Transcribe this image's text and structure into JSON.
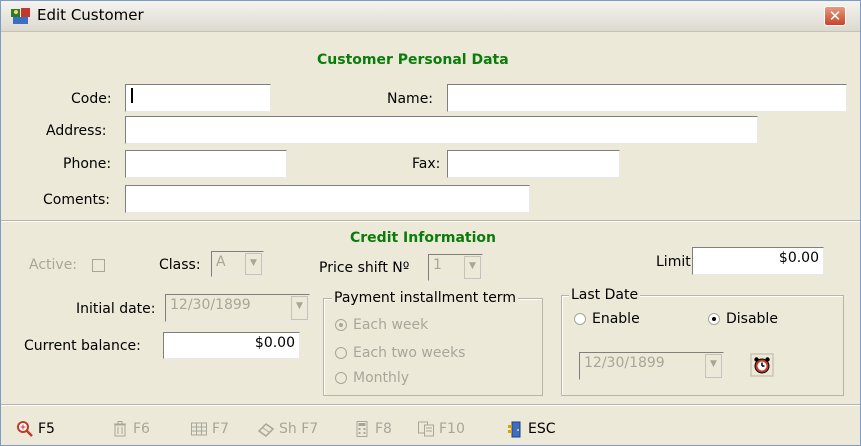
{
  "window": {
    "title": "Edit Customer",
    "close_label": "✕"
  },
  "personal": {
    "section_title": "Customer Personal Data",
    "code_label": "Code:",
    "code_value": "",
    "name_label": "Name:",
    "name_value": "",
    "address_label": "Address:",
    "address_value": "",
    "phone_label": "Phone:",
    "phone_value": "",
    "fax_label": "Fax:",
    "fax_value": "",
    "comments_label": "Coments:",
    "comments_value": ""
  },
  "credit": {
    "section_title": "Credit Information",
    "active_label": "Active:",
    "class_label": "Class:",
    "class_value": "A",
    "price_shift_label": "Price shift Nº",
    "price_shift_value": "1",
    "limit_label": "Limit:",
    "limit_value": "$0.00",
    "initial_date_label": "Initial date:",
    "initial_date_value": "12/30/1899",
    "current_balance_label": "Current balance:",
    "current_balance_value": "$0.00",
    "payment_term": {
      "title": "Payment installment term",
      "options": [
        "Each week",
        "Each two weeks",
        "Monthly"
      ],
      "selected": "Each week"
    },
    "last_date": {
      "title": "Last Date",
      "enable_label": "Enable",
      "disable_label": "Disable",
      "selected": "Disable",
      "date_value": "12/30/1899"
    }
  },
  "toolbar": {
    "items": [
      {
        "icon": "search-icon",
        "label": "F5",
        "enabled": true
      },
      {
        "icon": "trash-icon",
        "label": "F6",
        "enabled": false
      },
      {
        "icon": "grid-icon",
        "label": "F7",
        "enabled": false
      },
      {
        "icon": "eraser-icon",
        "label": "Sh F7",
        "enabled": false
      },
      {
        "icon": "calculator-icon",
        "label": "F8",
        "enabled": false
      },
      {
        "icon": "copy-icon",
        "label": "F10",
        "enabled": false
      },
      {
        "icon": "exit-door-icon",
        "label": "ESC",
        "enabled": true
      }
    ]
  },
  "colors": {
    "section_title": "#0a7c0a",
    "window_bg": "#ece9d8",
    "disabled_text": "#a7a69a"
  }
}
